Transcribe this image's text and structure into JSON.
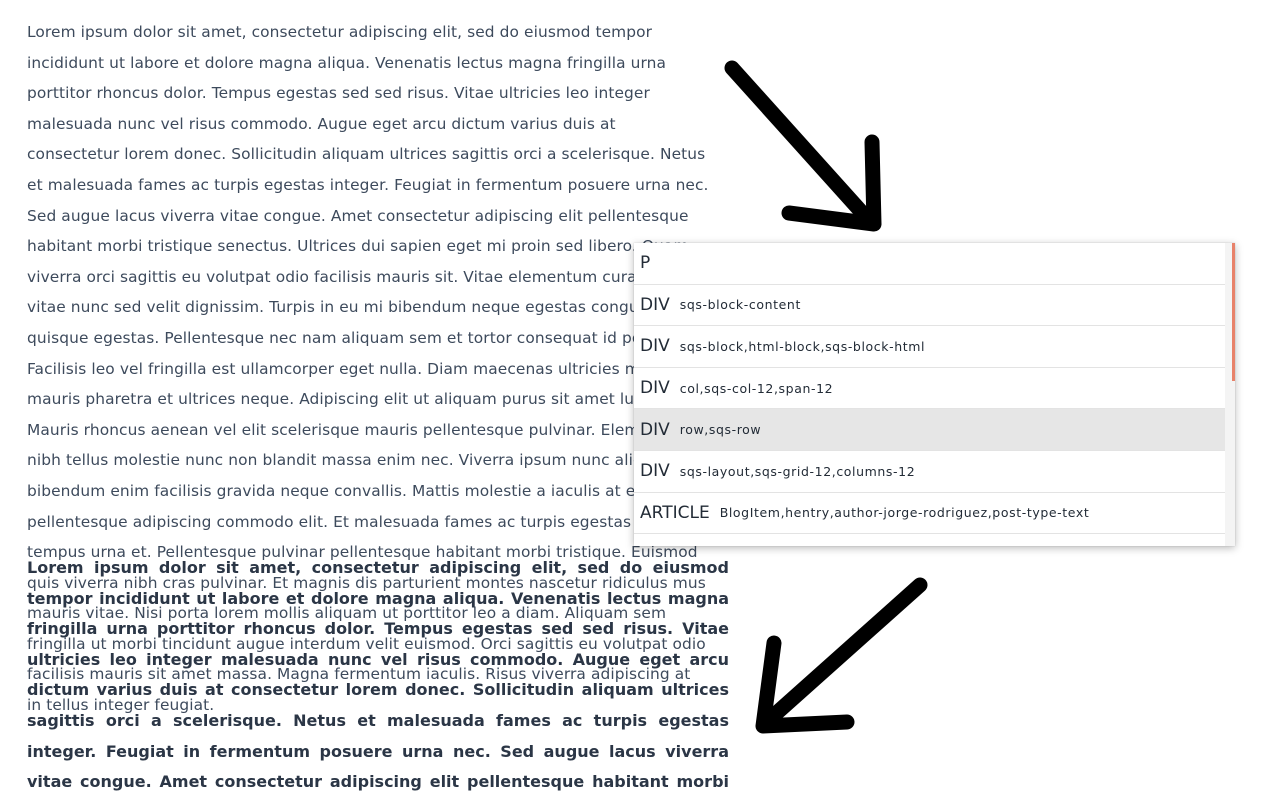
{
  "paragraph_top": "Lorem ipsum dolor sit amet, consectetur adipiscing elit, sed do eiusmod tempor incididunt ut labore et dolore magna aliqua. Venenatis lectus magna fringilla urna porttitor rhoncus dolor. Tempus egestas sed sed risus. Vitae ultricies leo integer malesuada nunc vel risus commodo. Augue eget arcu dictum varius duis at consectetur lorem donec. Sollicitudin aliquam ultrices sagittis orci a scelerisque. Netus et malesuada fames ac turpis egestas integer. Feugiat in fermentum posuere urna nec. Sed augue lacus viverra vitae congue. Amet consectetur adipiscing elit pellentesque habitant morbi tristique senectus. Ultrices dui sapien eget mi proin sed libero. Quam viverra orci sagittis eu volutpat odio facilisis mauris sit. Vitae elementum curabitur vitae nunc sed velit dignissim. Turpis in eu mi bibendum neque egestas congue quisque egestas. Pellentesque nec nam aliquam sem et tortor consequat id porta. Facilisis leo vel fringilla est ullamcorper eget nulla. Diam maecenas ultricies mi eget mauris pharetra et ultrices neque. Adipiscing elit ut aliquam purus sit amet luctus. Mauris rhoncus aenean vel elit scelerisque mauris pellentesque pulvinar. Elementum nibh tellus molestie nunc non blandit massa enim nec. Viverra ipsum nunc aliquet bibendum enim facilisis gravida neque convallis. Mattis molestie a iaculis at erat pellentesque adipiscing commodo elit. Et malesuada fames ac turpis egestas sed tempus urna et. Pellentesque pulvinar pellentesque habitant morbi tristique. Euismod quis viverra nibh cras pulvinar. Et magnis dis parturient montes nascetur ridiculus mus mauris vitae. Nisi porta lorem mollis aliquam ut porttitor leo a diam. Aliquam sem fringilla ut morbi tincidunt augue interdum velit euismod. Orci sagittis eu volutpat odio facilisis mauris sit amet massa. Magna fermentum iaculis. Risus viverra adipiscing at in tellus integer feugiat.",
  "paragraph_bottom": "Lorem ipsum dolor sit amet, consectetur adipiscing elit, sed do eiusmod tempor incididunt ut labore et dolore magna aliqua. Venenatis lectus magna fringilla urna porttitor rhoncus dolor. Tempus egestas sed sed risus. Vitae ultricies leo integer malesuada nunc vel risus commodo. Augue eget arcu dictum varius duis at consectetur lorem donec. Sollicitudin aliquam ultrices sagittis orci a scelerisque. Netus et malesuada fames ac turpis egestas integer. Feugiat in fermentum posuere urna nec. Sed augue lacus viverra vitae congue. Amet consectetur adipiscing elit pellentesque habitant morbi tristique senectus. Ultrices dui sapien",
  "inspector": {
    "rows": [
      {
        "tag": "P",
        "classes": ""
      },
      {
        "tag": "DIV",
        "classes": "sqs-block-content"
      },
      {
        "tag": "DIV",
        "classes": "sqs-block,html-block,sqs-block-html"
      },
      {
        "tag": "DIV",
        "classes": "col,sqs-col-12,span-12"
      },
      {
        "tag": "DIV",
        "classes": "row,sqs-row"
      },
      {
        "tag": "DIV",
        "classes": "sqs-layout,sqs-grid-12,columns-12"
      },
      {
        "tag": "ARTICLE",
        "classes": "BlogItem,hentry,author-jorge-rodriguez,post-type-text"
      }
    ],
    "selected_index": 4,
    "scroll_position": 0
  },
  "colors": {
    "accent_scrollbar": "#e8826a",
    "selected_row": "#e6e6e6",
    "arrow": "#000000",
    "body_text": "#3d4a5c"
  },
  "icons": {
    "arrow_top": "arrow-down-right-icon",
    "arrow_bottom": "arrow-down-left-icon"
  }
}
